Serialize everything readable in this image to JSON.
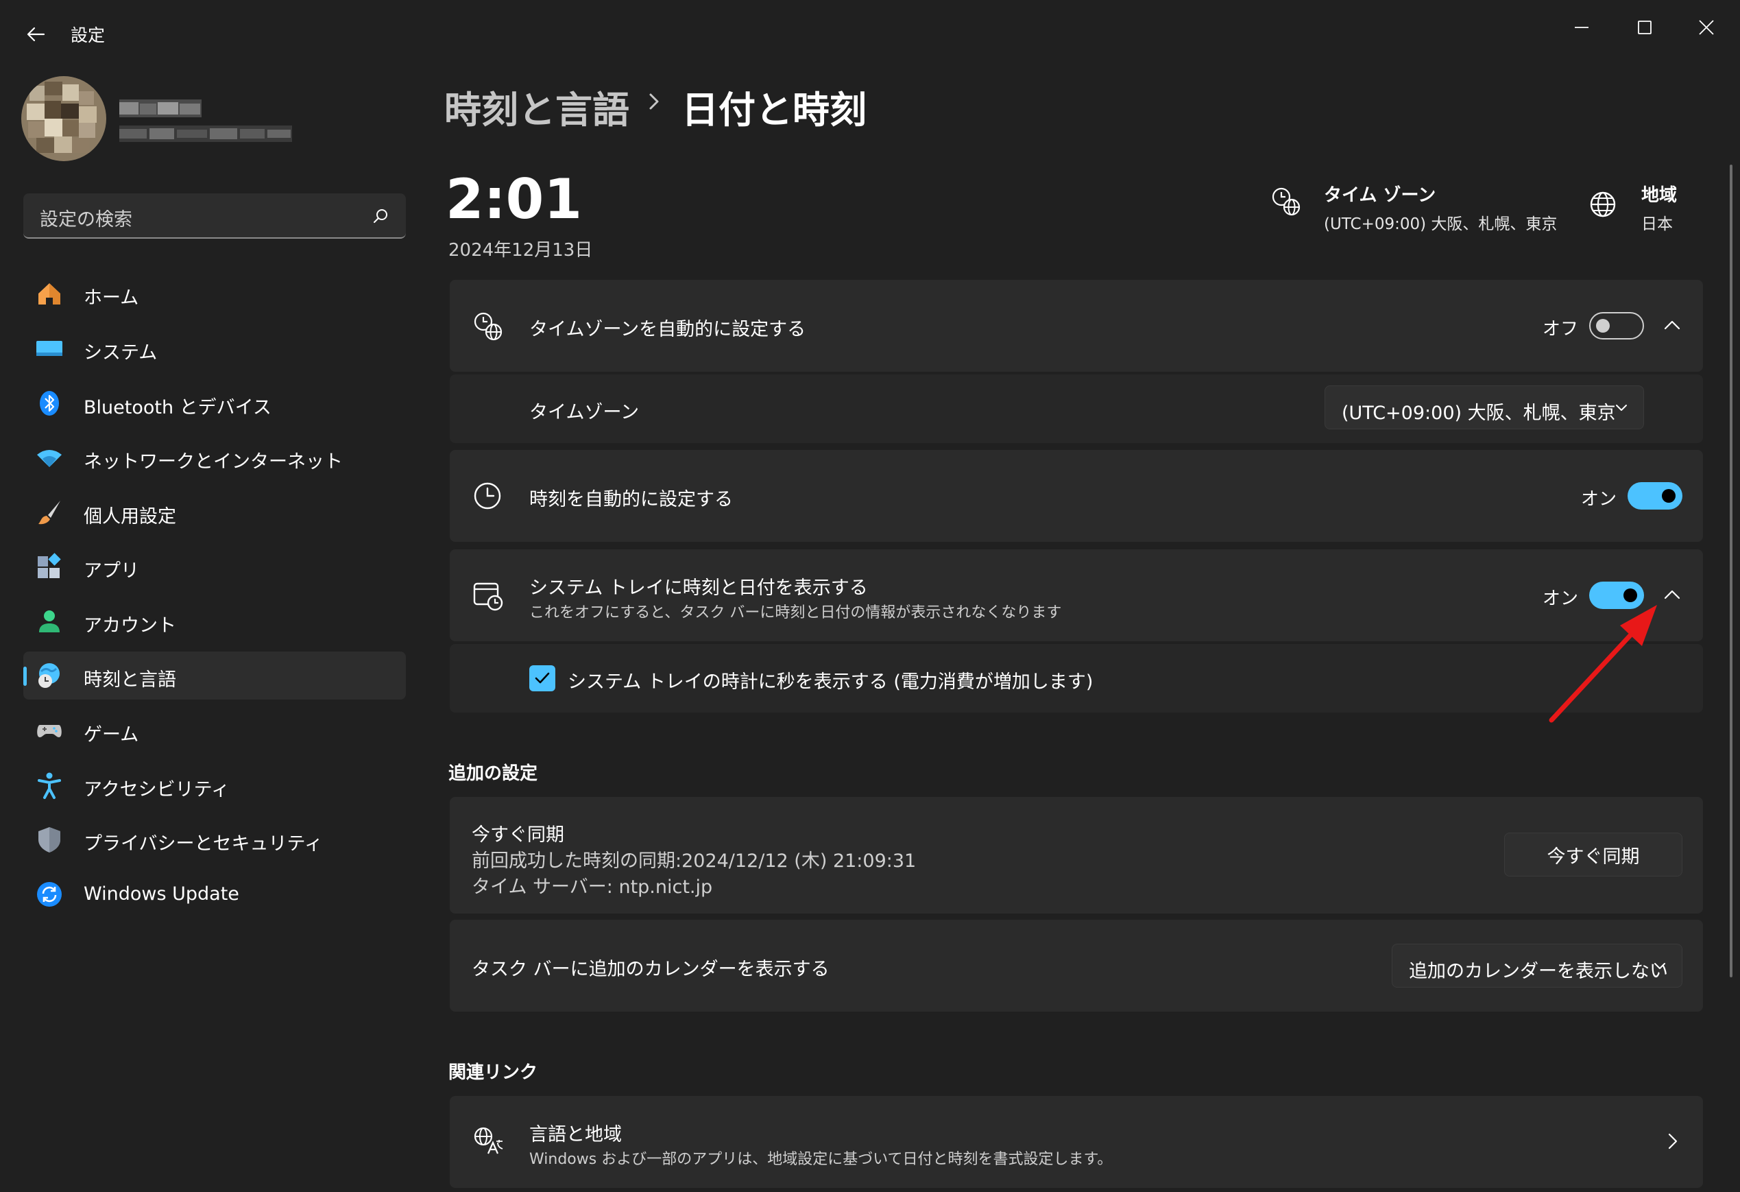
{
  "window": {
    "title": "設定",
    "back_icon": "arrow-left-icon",
    "minimize_icon": "minimize-icon",
    "maximize_icon": "maximize-icon",
    "close_icon": "close-icon"
  },
  "sidebar": {
    "search_placeholder": "設定の検索",
    "items": [
      {
        "label": "ホーム",
        "icon": "home-icon",
        "color": "#f7a14b"
      },
      {
        "label": "システム",
        "icon": "monitor-icon",
        "color": "#4cc2ff"
      },
      {
        "label": "Bluetooth とデバイス",
        "icon": "bluetooth-icon",
        "color": "#1a8cff"
      },
      {
        "label": "ネットワークとインターネット",
        "icon": "wifi-icon",
        "color": "#4cc2ff"
      },
      {
        "label": "個人用設定",
        "icon": "brush-icon",
        "color": "#f09a4a"
      },
      {
        "label": "アプリ",
        "icon": "apps-icon",
        "color": "#8fa3bf"
      },
      {
        "label": "アカウント",
        "icon": "account-icon",
        "color": "#3dd68c"
      },
      {
        "label": "時刻と言語",
        "icon": "time-language-icon",
        "color": "#4cc2ff",
        "selected": true
      },
      {
        "label": "ゲーム",
        "icon": "gamepad-icon",
        "color": "#c7c7c7"
      },
      {
        "label": "アクセシビリティ",
        "icon": "accessibility-icon",
        "color": "#4cc2ff"
      },
      {
        "label": "プライバシーとセキュリティ",
        "icon": "shield-icon",
        "color": "#9aa4b2"
      },
      {
        "label": "Windows Update",
        "icon": "update-icon",
        "color": "#1a8cff"
      }
    ]
  },
  "header": {
    "breadcrumb_parent": "時刻と言語",
    "breadcrumb_current": "日付と時刻",
    "time": "2:01",
    "date": "2024年12月13日",
    "timezone_title": "タイム ゾーン",
    "timezone_value": "(UTC+09:00) 大阪、札幌、東京",
    "region_title": "地域",
    "region_value": "日本"
  },
  "settings": {
    "auto_timezone": {
      "label": "タイムゾーンを自動的に設定する",
      "state": "オフ",
      "on": false
    },
    "timezone": {
      "label": "タイムゾーン",
      "value": "(UTC+09:00) 大阪、札幌、東京"
    },
    "auto_time": {
      "label": "時刻を自動的に設定する",
      "state": "オン",
      "on": true
    },
    "tray": {
      "label": "システム トレイに時刻と日付を表示する",
      "description": "これをオフにすると、タスク バーに時刻と日付の情報が表示されなくなります",
      "state": "オン",
      "on": true
    },
    "tray_seconds": {
      "label": "システム トレイの時計に秒を表示する (電力消費が増加します)",
      "checked": true
    }
  },
  "additional": {
    "section_title": "追加の設定",
    "sync": {
      "title": "今すぐ同期",
      "last_sync": "前回成功した時刻の同期:2024/12/12 (木) 21:09:31",
      "server": "タイム サーバー: ntp.nict.jp",
      "button": "今すぐ同期"
    },
    "calendar": {
      "label": "タスク バーに追加のカレンダーを表示する",
      "value": "追加のカレンダーを表示しない"
    }
  },
  "related": {
    "section_title": "関連リンク",
    "language_region": {
      "title": "言語と地域",
      "description": "Windows および一部のアプリは、地域設定に基づいて日付と時刻を書式設定します。"
    }
  },
  "colors": {
    "accent": "#4cc2ff",
    "background": "#202020",
    "card": "#2b2b2b",
    "annotation_arrow": "#e81818"
  }
}
